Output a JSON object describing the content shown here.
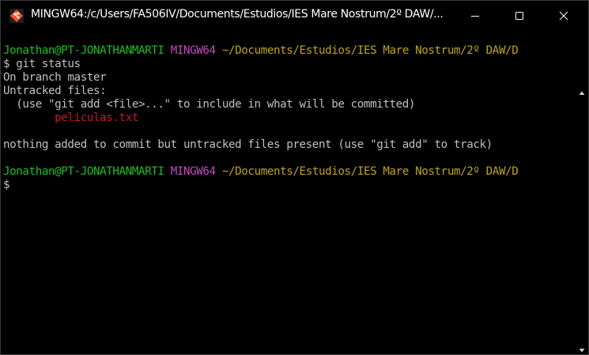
{
  "window": {
    "title": "MINGW64:/c/Users/FA506IV/Documents/Estudios/IES Mare Nostrum/2º DAW/...",
    "icon": "git-bash-icon",
    "controls": {
      "minimize": "minimize-icon",
      "maximize": "maximize-icon",
      "close": "close-icon"
    }
  },
  "terminal": {
    "prompt1": {
      "user_host": "Jonathan@PT-JONATHANMARTI",
      "shell": "MINGW64",
      "path": "~/Documents/Estudios/IES Mare Nostrum/2º DAW/D"
    },
    "command": "$ git status",
    "output": [
      "On branch master",
      "Untracked files:",
      "  (use \"git add <file>...\" to include in what will be committed)"
    ],
    "untracked_file": "        peliculas.txt",
    "summary": "nothing added to commit but untracked files present (use \"git add\" to track)",
    "prompt2": {
      "user_host": "Jonathan@PT-JONATHANMARTI",
      "shell": "MINGW64",
      "path": "~/Documents/Estudios/IES Mare Nostrum/2º DAW/D"
    },
    "current_prompt": "$"
  },
  "colors": {
    "background": "#000000",
    "user_host": "#1cc024",
    "shell": "#c04bc0",
    "path": "#c0a21e",
    "text": "#c0c0c0",
    "untracked": "#c01c28"
  }
}
